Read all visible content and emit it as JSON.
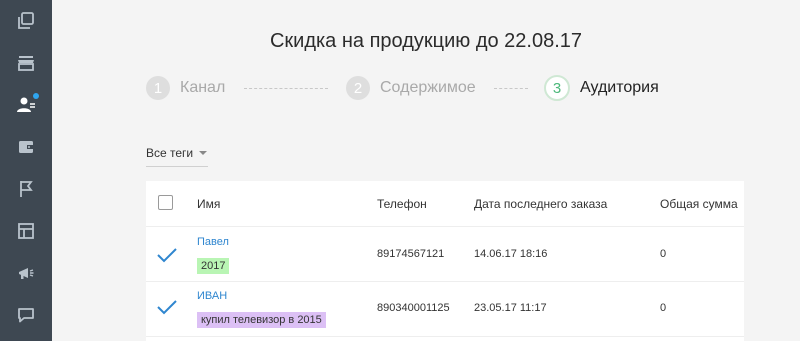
{
  "sidebar": {
    "items": [
      {
        "icon": "copy-icon"
      },
      {
        "icon": "store-icon"
      },
      {
        "icon": "users-icon",
        "active": true,
        "notification": true
      },
      {
        "icon": "wallet-icon"
      },
      {
        "icon": "flag-icon"
      },
      {
        "icon": "layout-icon"
      },
      {
        "icon": "megaphone-icon"
      },
      {
        "icon": "chat-icon"
      }
    ],
    "colors": {
      "background": "#3e4852",
      "icon": "#b9c3cc",
      "active_icon": "#ffffff",
      "dot": "#2fa6f0"
    }
  },
  "page": {
    "title": "Скидка на продукцию до 22.08.17"
  },
  "steps": [
    {
      "number": "1",
      "label": "Канал",
      "state": "done"
    },
    {
      "number": "2",
      "label": "Содержимое",
      "state": "done"
    },
    {
      "number": "3",
      "label": "Аудитория",
      "state": "active"
    }
  ],
  "filter": {
    "tags_label": "Все теги"
  },
  "table": {
    "headers": {
      "name": "Имя",
      "phone": "Телефон",
      "last_order": "Дата последнего заказа",
      "total": "Общая сумма"
    },
    "rows": [
      {
        "checked": true,
        "name": "Павел",
        "tag": "2017",
        "tag_color": "#b9f5b4",
        "phone": "89174567121",
        "last_order": "14.06.17 18:16",
        "total": "0"
      },
      {
        "checked": true,
        "name": "ИВАН",
        "tag": "купил телевизор в 2015",
        "tag_color": "#dcc0f5",
        "phone": "890340001125",
        "last_order": "23.05.17 11:17",
        "total": "0"
      }
    ]
  },
  "colors": {
    "accent": "#2f86cf",
    "active_step": "#4cb87a"
  }
}
